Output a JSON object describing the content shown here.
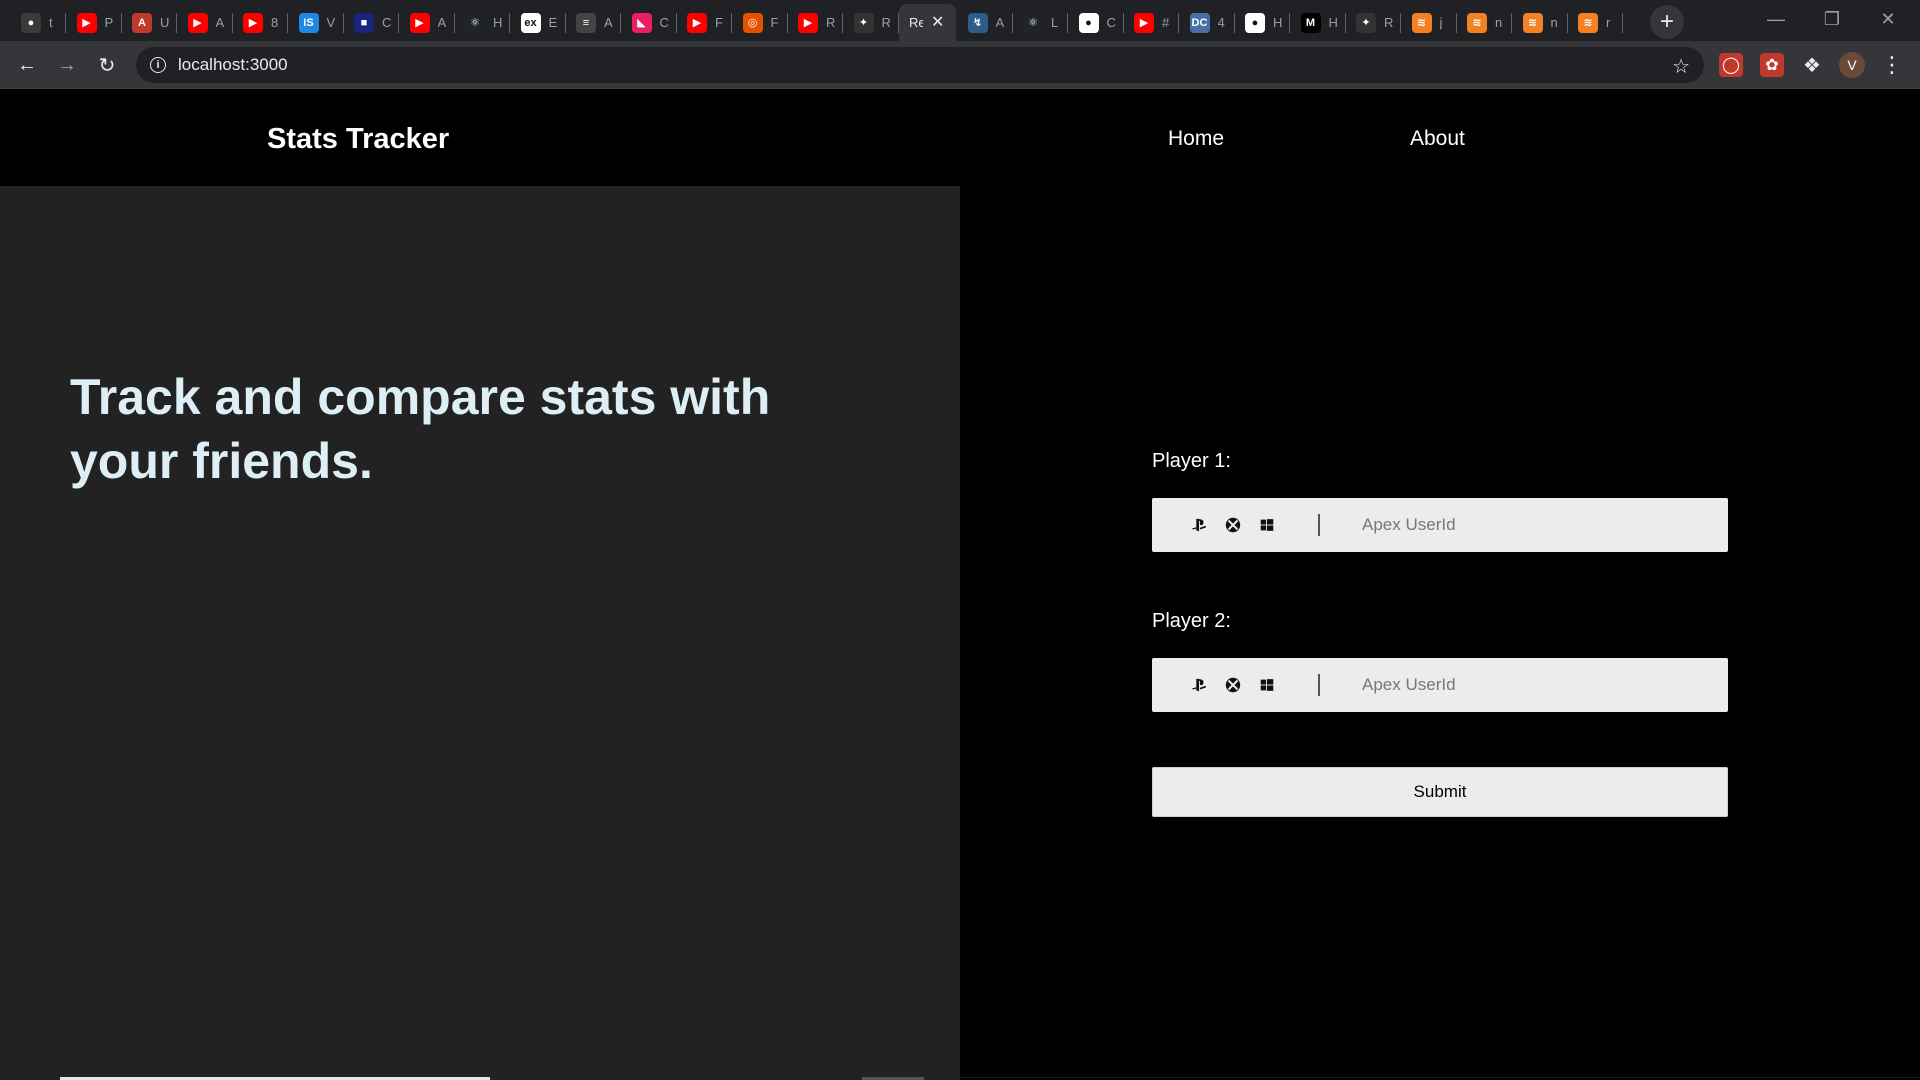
{
  "browser": {
    "tabs": [
      {
        "label": "t",
        "favicon_color": "#3a3a3a",
        "favicon_glyph": "●",
        "icon": "github-icon"
      },
      {
        "label": "P",
        "favicon_color": "#ff0000",
        "favicon_glyph": "▶",
        "icon": "youtube-icon"
      },
      {
        "label": "U",
        "favicon_color": "#c0392b",
        "favicon_glyph": "A",
        "icon": "app-icon"
      },
      {
        "label": "A",
        "favicon_color": "#ff0000",
        "favicon_glyph": "▶",
        "icon": "youtube-icon"
      },
      {
        "label": "8",
        "favicon_color": "#ff0000",
        "favicon_glyph": "▶",
        "icon": "youtube-icon"
      },
      {
        "label": "V",
        "favicon_color": "#1e88e5",
        "favicon_glyph": "IS",
        "icon": "site-icon"
      },
      {
        "label": "C",
        "favicon_color": "#1a237e",
        "favicon_glyph": "■",
        "icon": "site-icon"
      },
      {
        "label": "A",
        "favicon_color": "#ff0000",
        "favicon_glyph": "▶",
        "icon": "youtube-icon"
      },
      {
        "label": "H",
        "favicon_color": "#20232a",
        "favicon_glyph": "⚛",
        "icon": "react-icon"
      },
      {
        "label": "E",
        "favicon_color": "#ffffff",
        "favicon_glyph": "ex",
        "icon": "express-icon"
      },
      {
        "label": "A",
        "favicon_color": "#444444",
        "favicon_glyph": "≡",
        "icon": "site-icon"
      },
      {
        "label": "C",
        "favicon_color": "#e91e63",
        "favicon_glyph": "◣",
        "icon": "site-icon"
      },
      {
        "label": "F",
        "favicon_color": "#ff0000",
        "favicon_glyph": "▶",
        "icon": "youtube-icon"
      },
      {
        "label": "F",
        "favicon_color": "#e65100",
        "favicon_glyph": "◎",
        "icon": "site-icon"
      },
      {
        "label": "R",
        "favicon_color": "#ff0000",
        "favicon_glyph": "▶",
        "icon": "youtube-icon"
      },
      {
        "label": "R",
        "favicon_color": "#333333",
        "favicon_glyph": "✦",
        "icon": "site-icon"
      },
      {
        "label": "Re",
        "favicon_color": "#35363a",
        "favicon_glyph": "",
        "icon": "site-icon",
        "active": true
      },
      {
        "label": "A",
        "favicon_color": "#2c5d8a",
        "favicon_glyph": "↯",
        "icon": "site-icon"
      },
      {
        "label": "L",
        "favicon_color": "#20232a",
        "favicon_glyph": "⚛",
        "icon": "react-icon"
      },
      {
        "label": "C",
        "favicon_color": "#ffffff",
        "favicon_glyph": "●",
        "icon": "site-icon"
      },
      {
        "label": "#",
        "favicon_color": "#ff0000",
        "favicon_glyph": "▶",
        "icon": "youtube-icon"
      },
      {
        "label": "4",
        "favicon_color": "#4a6fa5",
        "favicon_glyph": "DC",
        "icon": "site-icon"
      },
      {
        "label": "H",
        "favicon_color": "#ffffff",
        "favicon_glyph": "●",
        "icon": "site-icon"
      },
      {
        "label": "H",
        "favicon_color": "#000000",
        "favicon_glyph": "M",
        "icon": "medium-icon"
      },
      {
        "label": "R",
        "favicon_color": "#333333",
        "favicon_glyph": "✦",
        "icon": "site-icon"
      },
      {
        "label": "j",
        "favicon_color": "#f48024",
        "favicon_glyph": "≋",
        "icon": "stackoverflow-icon"
      },
      {
        "label": "n",
        "favicon_color": "#f48024",
        "favicon_glyph": "≋",
        "icon": "stackoverflow-icon"
      },
      {
        "label": "n",
        "favicon_color": "#f48024",
        "favicon_glyph": "≋",
        "icon": "stackoverflow-icon"
      },
      {
        "label": "r",
        "favicon_color": "#f48024",
        "favicon_glyph": "≋",
        "icon": "stackoverflow-icon"
      }
    ],
    "url": "localhost:3000",
    "profile_initial": "V"
  },
  "header": {
    "brand": "Stats Tracker",
    "nav": [
      "Home",
      "About"
    ]
  },
  "hero": {
    "headline": "Track and compare stats with your friends."
  },
  "form": {
    "player1_label": "Player 1:",
    "player2_label": "Player 2:",
    "input_placeholder": "Apex UserId",
    "submit_label": "Submit",
    "platforms": [
      "playstation-icon",
      "xbox-icon",
      "windows-icon"
    ]
  }
}
